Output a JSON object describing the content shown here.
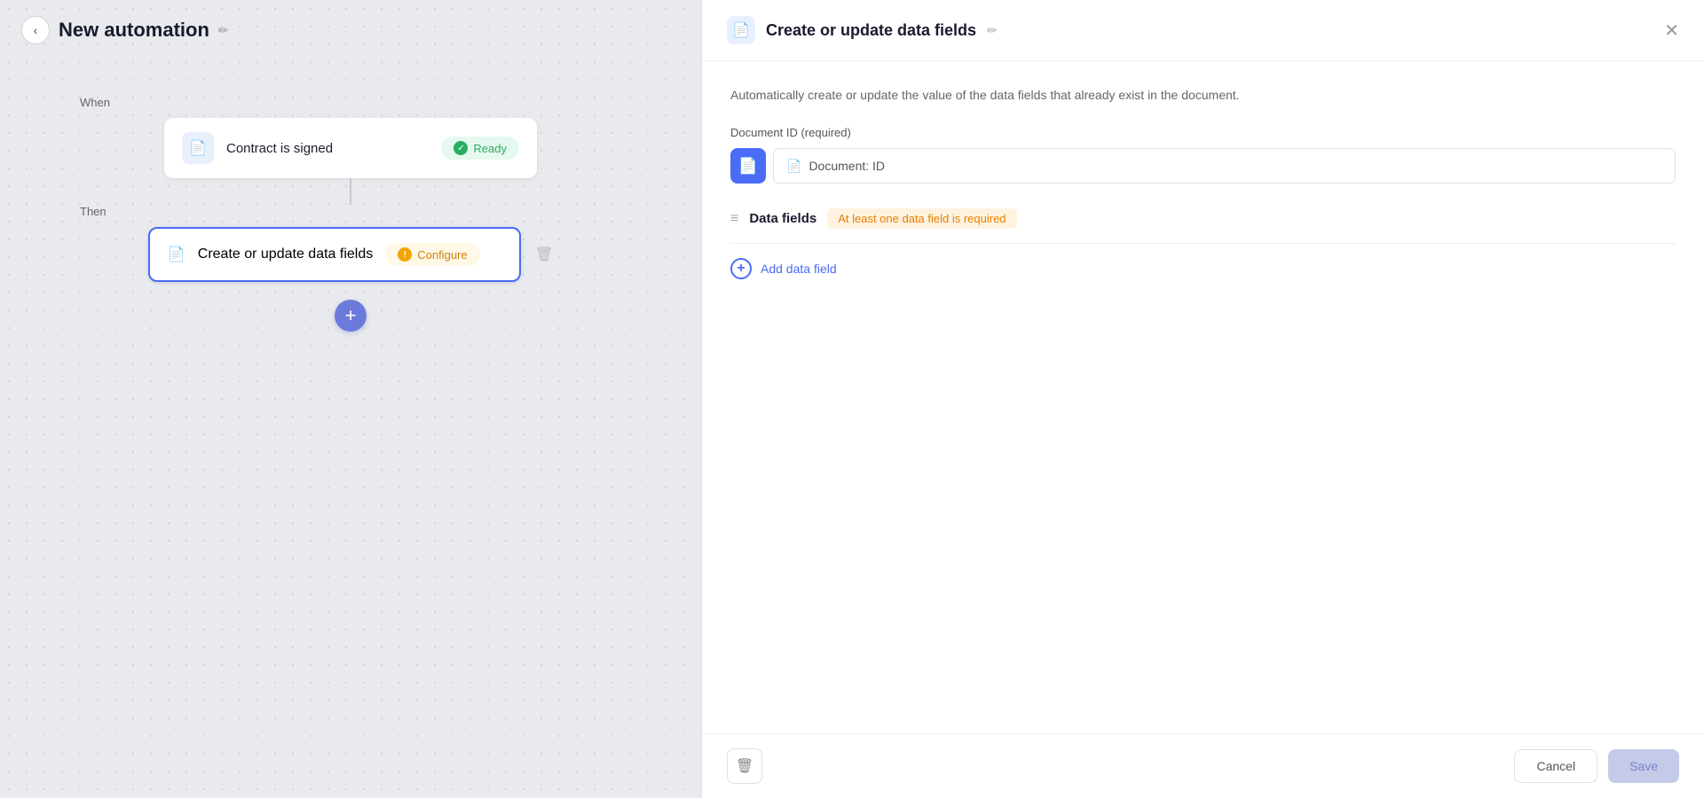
{
  "page": {
    "title": "New automation",
    "edit_label": "✏"
  },
  "left": {
    "back_label": "‹",
    "when_label": "When",
    "then_label": "Then",
    "trigger": {
      "icon": "📄",
      "title": "Contract is signed",
      "badge": "Ready",
      "badge_check": "✓"
    },
    "action": {
      "icon": "📄",
      "title": "Create or update data fields",
      "badge": "Configure",
      "badge_warn": "!"
    },
    "add_btn": "+"
  },
  "right": {
    "header": {
      "icon": "📄",
      "title": "Create or update data fields",
      "edit_label": "✏",
      "close_label": "✕"
    },
    "description": "Automatically create or update the value of the data fields that already exist in the document.",
    "document_id": {
      "label": "Document ID (required)",
      "icon": "📄",
      "field_icon": "📄",
      "field_value": "Document: ID"
    },
    "data_fields": {
      "section_title": "Data fields",
      "warning": "At least one data field is required",
      "add_label": "Add data field",
      "section_icon": "≡",
      "plus_icon": "+"
    },
    "footer": {
      "delete_icon": "🗑",
      "cancel_label": "Cancel",
      "save_label": "Save"
    }
  }
}
